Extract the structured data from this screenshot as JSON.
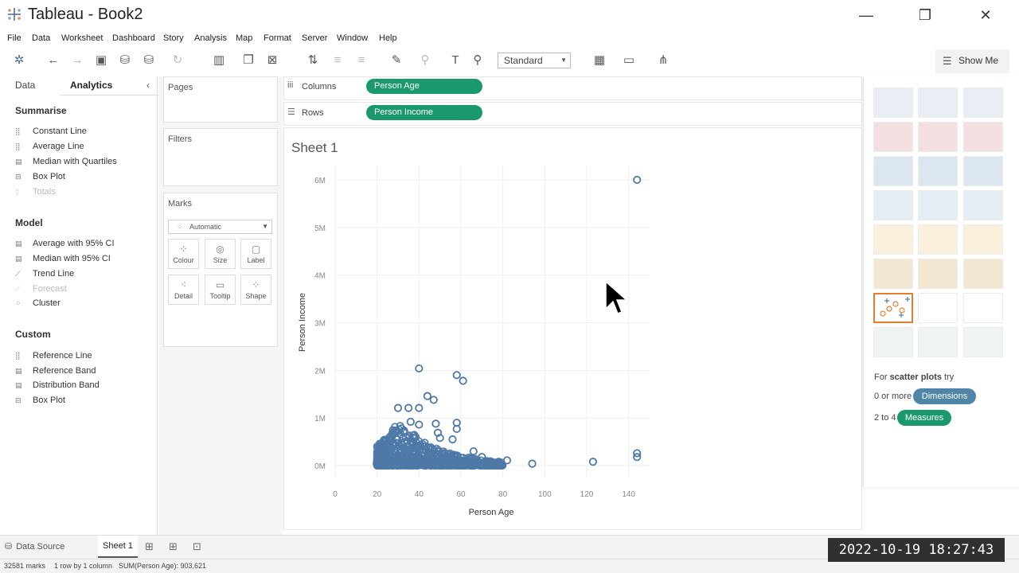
{
  "window": {
    "title": "Tableau - Book2",
    "minimize": "—",
    "restore": "❐",
    "close": "✕"
  },
  "menu": [
    "File",
    "Data",
    "Worksheet",
    "Dashboard",
    "Story",
    "Analysis",
    "Map",
    "Format",
    "Server",
    "Window",
    "Help"
  ],
  "toolbar": {
    "fit_select": "Standard",
    "show_me_label": "Show Me"
  },
  "side_pane": {
    "tabs": {
      "data": "Data",
      "analytics": "Analytics"
    },
    "summarise": {
      "title": "Summarise",
      "items": [
        "Constant Line",
        "Average Line",
        "Median with Quartiles",
        "Box Plot",
        "Totals"
      ]
    },
    "model": {
      "title": "Model",
      "items": [
        "Average with 95% CI",
        "Median with 95% CI",
        "Trend Line",
        "Forecast",
        "Cluster"
      ]
    },
    "custom": {
      "title": "Custom",
      "items": [
        "Reference Line",
        "Reference Band",
        "Distribution Band",
        "Box Plot"
      ]
    }
  },
  "cards": {
    "pages": "Pages",
    "filters": "Filters",
    "marks": "Marks",
    "mark_type": "Automatic",
    "buttons": [
      "Colour",
      "Size",
      "Label",
      "Detail",
      "Tooltip",
      "Shape"
    ]
  },
  "shelves": {
    "columns_label": "Columns",
    "columns_pill": "Person Age",
    "rows_label": "Rows",
    "rows_pill": "Person Income"
  },
  "sheet": {
    "title": "Sheet 1"
  },
  "chart_data": {
    "type": "scatter",
    "title": "",
    "xlabel": "Person Age",
    "ylabel": "Person Income",
    "xlim": [
      0,
      150
    ],
    "ylim": [
      -250000,
      6300000
    ],
    "x_ticks": [
      0,
      20,
      40,
      60,
      80,
      100,
      120,
      140
    ],
    "x_tick_labels": [
      "0",
      "20",
      "40",
      "60",
      "80",
      "100",
      "120",
      "140"
    ],
    "y_ticks": [
      0,
      1000000,
      2000000,
      3000000,
      4000000,
      5000000,
      6000000
    ],
    "y_tick_labels": [
      "0M",
      "1M",
      "2M",
      "3M",
      "4M",
      "5M",
      "6M"
    ],
    "marker": "open-circle",
    "color": "#4e79a7",
    "grid": true,
    "outliers": [
      [
        144,
        6000000
      ],
      [
        40,
        2040000
      ],
      [
        58,
        1900000
      ],
      [
        61,
        1780000
      ],
      [
        44,
        1460000
      ],
      [
        47,
        1380000
      ],
      [
        30,
        1210000
      ],
      [
        35,
        1210000
      ],
      [
        40,
        1210000
      ],
      [
        36,
        920000
      ],
      [
        40,
        860000
      ],
      [
        48,
        880000
      ],
      [
        58,
        900000
      ],
      [
        58,
        770000
      ],
      [
        49,
        690000
      ],
      [
        50,
        580000
      ],
      [
        56,
        550000
      ],
      [
        66,
        300000
      ],
      [
        70,
        180000
      ],
      [
        78,
        80000
      ],
      [
        82,
        110000
      ],
      [
        94,
        40000
      ],
      [
        123,
        80000
      ],
      [
        144,
        180000
      ],
      [
        144,
        260000
      ]
    ],
    "cluster": {
      "x_range": [
        20,
        80
      ],
      "y_max_by_age": [
        [
          20,
          420000
        ],
        [
          25,
          620000
        ],
        [
          30,
          900000
        ],
        [
          35,
          780000
        ],
        [
          40,
          560000
        ],
        [
          45,
          430000
        ],
        [
          50,
          330000
        ],
        [
          55,
          260000
        ],
        [
          60,
          200000
        ],
        [
          65,
          160000
        ],
        [
          70,
          120000
        ],
        [
          75,
          90000
        ],
        [
          80,
          70000
        ]
      ]
    }
  },
  "show_me": {
    "hint_prefix": "For ",
    "hint_bold": "scatter plots",
    "hint_suffix": " try",
    "dimensions_prefix": "0 or more",
    "dimensions": "Dimensions",
    "measures_prefix": "2 to 4",
    "measures": "Measures",
    "dimensions_color": "#4f86a7",
    "measures_color": "#1a9a6c"
  },
  "bottom": {
    "data_source": "Data Source",
    "sheet_tab": "Sheet 1"
  },
  "status": {
    "marks": "32581 marks",
    "layout": "1 row by 1 column",
    "sum": "SUM(Person Age): 903,621"
  },
  "timestamp": "2022-10-19 18:27:43"
}
